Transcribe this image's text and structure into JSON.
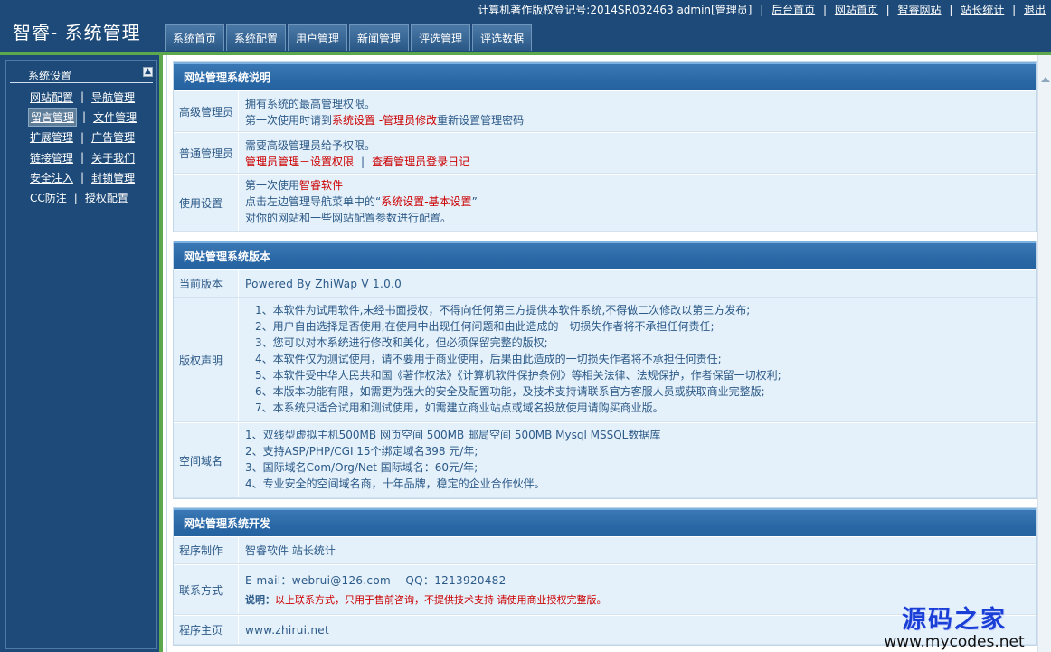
{
  "header": {
    "logo": "智睿- 系统管理",
    "top_info": "计算机著作版权登记号:2014SR032463 admin[管理员]",
    "top_links": [
      "后台首页",
      "网站首页",
      "智睿网站",
      "站长统计",
      "退出"
    ],
    "tabs": [
      "系统首页",
      "系统配置",
      "用户管理",
      "新闻管理",
      "评选管理",
      "评选数据"
    ]
  },
  "sidebar": {
    "title": "系统设置",
    "rows": [
      [
        "网站配置",
        "导航管理"
      ],
      [
        "留言管理",
        "文件管理"
      ],
      [
        "扩展管理",
        "广告管理"
      ],
      [
        "链接管理",
        "关于我们"
      ],
      [
        "安全注入",
        "封锁管理"
      ],
      [
        "CC防注",
        "授权配置"
      ]
    ],
    "active": "留言管理"
  },
  "sections": {
    "s1": {
      "title": "网站管理系统说明",
      "super_label": "高级管理员",
      "super_line1": "拥有系统的最高管理权限。",
      "super_line2_a": "第一次使用时请到",
      "super_line2_b": "系统设置 -管理员修改",
      "super_line2_c": "重新设置管理密码",
      "normal_label": "普通管理员",
      "normal_line1": "需要高级管理员给予权限。",
      "normal_link1": "管理员管理－设置权限",
      "normal_sep": "|",
      "normal_link2": "查看管理员登录日记",
      "use_label": "使用设置",
      "use_line1_a": "第一次使用",
      "use_line1_b": "智睿软件",
      "use_line2_a": "点击左边管理导航菜单中的“",
      "use_line2_b": "系统设置-基本设置",
      "use_line2_c": "”",
      "use_line3": "对你的网站和一些网站配置参数进行配置。"
    },
    "s2": {
      "title": "网站管理系统版本",
      "ver_label": "当前版本",
      "ver_value": "Powered By ZhiWap V 1.0.0",
      "copy_label": "版权声明",
      "copy_lines": [
        "1、本软件为试用软件,未经书面授权，不得向任何第三方提供本软件系统,不得做二次修改以第三方发布;",
        "2、用户自由选择是否使用,在使用中出现任何问题和由此造成的一切损失作者将不承担任何责任;",
        "3、您可以对本系统进行修改和美化，但必须保留完整的版权;",
        "4、本软件仅为测试使用，请不要用于商业使用，后果由此造成的一切损失作者将不承担任何责任;",
        "5、本软件受中华人民共和国《著作权法》《计算机软件保护条例》等相关法律、法规保护，作者保留一切权利;",
        "6、本版本功能有限，如需更为强大的安全及配置功能，及技术支持请联系官方客服人员或获取商业完整版;",
        "7、本系统只适合试用和测试使用，如需建立商业站点或域名投放使用请购买商业版。"
      ],
      "domain_label": "空间域名",
      "domain_lines": [
        "1、双线型虚拟主机500MB 网页空间 500MB 邮局空间 500MB Mysql MSSQL数据库",
        "2、支持ASP/PHP/CGI 15个绑定域名398 元/年;",
        "3、国际域名Com/Org/Net 国际域名：60元/年;",
        "4、专业安全的空间域名商，十年品牌，稳定的企业合作伙伴。"
      ]
    },
    "s3": {
      "title": "网站管理系统开发",
      "dev_label": "程序制作",
      "dev_value": "智睿软件 站长统计",
      "contact_label": "联系方式",
      "contact_line1": "E-mail：webrui@126.com    QQ：1213920482",
      "contact_note_a": "说明：",
      "contact_note_b": "以上联系方式，只用于售前咨询，不提供技术支持 请使用商业授权完整版。",
      "home_label": "程序主页",
      "home_value": "www.zhirui.net"
    }
  },
  "watermark": {
    "cn": "源码之家",
    "url": "www.mycodes.net"
  }
}
